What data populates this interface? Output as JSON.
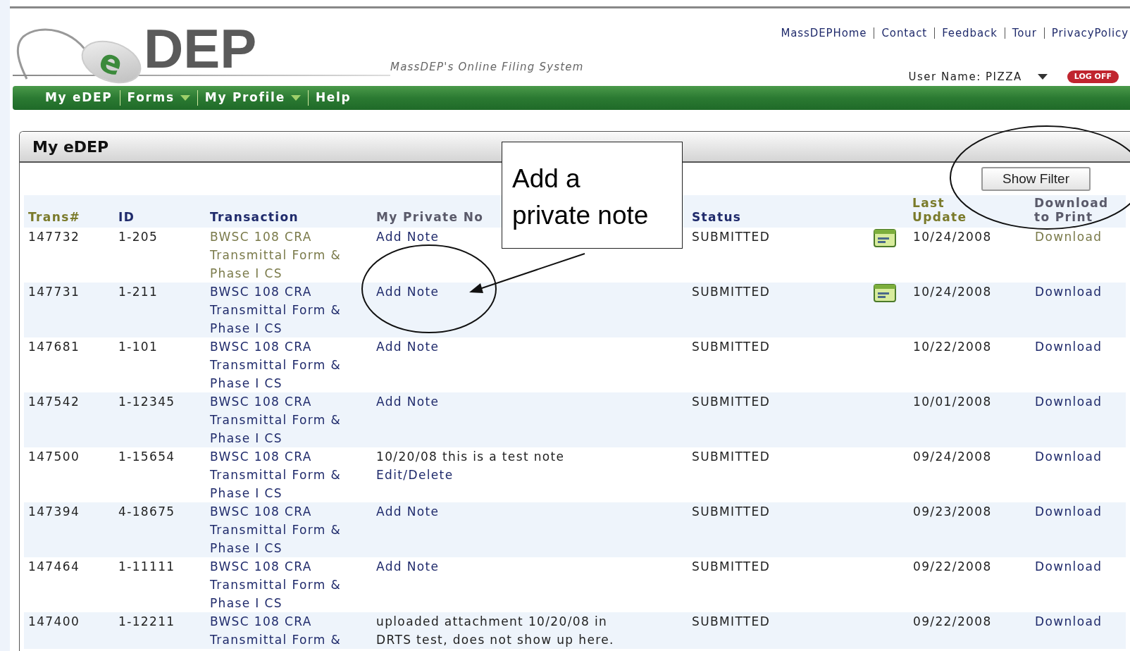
{
  "header": {
    "logo": {
      "mark": "e",
      "name": "DEP"
    },
    "tagline": "MassDEP's Online Filing System",
    "top_links": [
      "MassDEPHome",
      "Contact",
      "Feedback",
      "Tour",
      "PrivacyPolicy"
    ],
    "user": "User Name: PIZZA",
    "logoff": "LOG OFF"
  },
  "nav": [
    {
      "label": "My eDEP",
      "has_menu": false
    },
    {
      "label": "Forms",
      "has_menu": true
    },
    {
      "label": "My Profile",
      "has_menu": true
    },
    {
      "label": "Help",
      "has_menu": false
    }
  ],
  "panel": {
    "title": "My eDEP",
    "filter_button": "Show Filter"
  },
  "table": {
    "columns": [
      "Trans#",
      "ID",
      "Transaction",
      "My Private No",
      "Status",
      "Last Update",
      "Download to Print"
    ],
    "rows": [
      {
        "trans": "147732",
        "id": "1-205",
        "transaction": "BWSC 108 CRA Transmittal Form & Phase I CS",
        "visited": true,
        "note": {
          "kind": "add",
          "link": "Add Note"
        },
        "status": "SUBMITTED",
        "has_icon": true,
        "updated": "10/24/2008",
        "download": "Download"
      },
      {
        "trans": "147731",
        "id": "1-211",
        "transaction": "BWSC 108 CRA Transmittal Form & Phase I CS",
        "visited": false,
        "note": {
          "kind": "add",
          "link": "Add Note"
        },
        "status": "SUBMITTED",
        "has_icon": true,
        "updated": "10/24/2008",
        "download": "Download"
      },
      {
        "trans": "147681",
        "id": "1-101",
        "transaction": "BWSC 108 CRA Transmittal Form & Phase I CS",
        "visited": false,
        "note": {
          "kind": "add",
          "link": "Add Note"
        },
        "status": "SUBMITTED",
        "has_icon": false,
        "updated": "10/22/2008",
        "download": "Download"
      },
      {
        "trans": "147542",
        "id": "1-12345",
        "transaction": "BWSC 108 CRA Transmittal Form & Phase I CS",
        "visited": false,
        "note": {
          "kind": "add",
          "link": "Add Note"
        },
        "status": "SUBMITTED",
        "has_icon": false,
        "updated": "10/01/2008",
        "download": "Download"
      },
      {
        "trans": "147500",
        "id": "1-15654",
        "transaction": "BWSC 108 CRA Transmittal Form & Phase I CS",
        "visited": false,
        "note": {
          "kind": "text",
          "text": "10/20/08 this is a test note",
          "link": "Edit/Delete"
        },
        "status": "SUBMITTED",
        "has_icon": false,
        "updated": "09/24/2008",
        "download": "Download"
      },
      {
        "trans": "147394",
        "id": "4-18675",
        "transaction": "BWSC 108 CRA Transmittal Form & Phase I CS",
        "visited": false,
        "note": {
          "kind": "add",
          "link": "Add Note"
        },
        "status": "SUBMITTED",
        "has_icon": false,
        "updated": "09/23/2008",
        "download": "Download"
      },
      {
        "trans": "147464",
        "id": "1-11111",
        "transaction": "BWSC 108 CRA Transmittal Form & Phase I CS",
        "visited": false,
        "note": {
          "kind": "add",
          "link": "Add Note"
        },
        "status": "SUBMITTED",
        "has_icon": false,
        "updated": "09/22/2008",
        "download": "Download"
      },
      {
        "trans": "147400",
        "id": "1-12211",
        "transaction": "BWSC 108 CRA Transmittal Form &",
        "visited": false,
        "note": {
          "kind": "text",
          "text": "uploaded attachment 10/20/08 in DRTS test, does not show up here."
        },
        "status": "SUBMITTED",
        "has_icon": false,
        "updated": "09/22/2008",
        "download": "Download"
      }
    ]
  },
  "callout": {
    "text": "Add a private note"
  }
}
